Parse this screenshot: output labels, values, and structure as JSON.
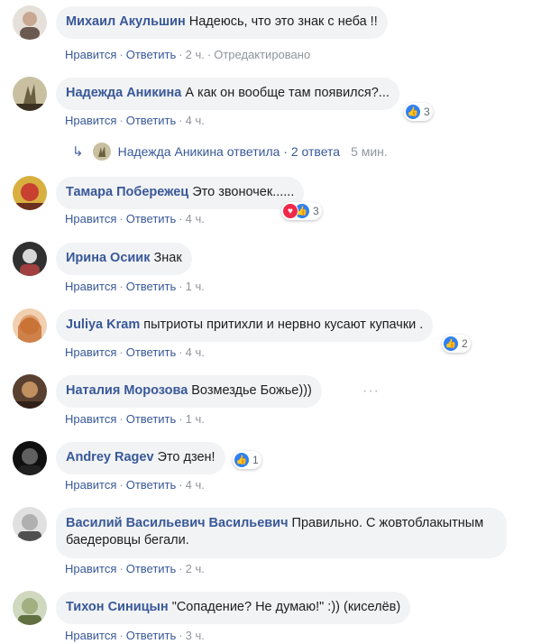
{
  "comments": [
    {
      "author": "Михаил Акульшин",
      "text": "Надеюсь, что это знак с неба !!",
      "like": "Нравится",
      "reply": "Ответить",
      "time": "2 ч.",
      "edited": "Отредактировано",
      "colors": [
        "#e6e0da",
        "#c8a890",
        "#6a5a50"
      ]
    },
    {
      "author": "Надежда Аникина",
      "text": "А как он вообще там появился?...",
      "like": "Нравится",
      "reply": "Ответить",
      "time": "4 ч.",
      "reactions": "3",
      "colors": [
        "#c8c0a0",
        "#6a6040",
        "#3a3020"
      ]
    },
    {
      "author": "Тамара Побережец",
      "text": "Это звоночек......",
      "like": "Нравится",
      "reply": "Ответить",
      "time": "4 ч.",
      "reactions": "3",
      "colors": [
        "#d8b040",
        "#c84030",
        "#6a3020"
      ]
    },
    {
      "author": "Ирина Осиик",
      "text": "Знак",
      "like": "Нравится",
      "reply": "Ответить",
      "time": "1 ч.",
      "colors": [
        "#303030",
        "#a04040",
        "#d8d8d8"
      ]
    },
    {
      "author": "Juliya Kram",
      "text": "пытриоты притихли и нервно кусают купачки .",
      "like": "Нравится",
      "reply": "Ответить",
      "time": "4 ч.",
      "reactions": "2",
      "colors": [
        "#e0a070",
        "#c06020",
        "#f0d0b0"
      ]
    },
    {
      "author": "Наталия Морозова",
      "text": "Возмездье Божье)))",
      "like": "Нравится",
      "reply": "Ответить",
      "time": "1 ч.",
      "colors": [
        "#5a4030",
        "#c09060",
        "#302018"
      ]
    },
    {
      "author": "Andrey Ragev",
      "text": "Это дзен!",
      "like": "Нравится",
      "reply": "Ответить",
      "time": "4 ч.",
      "reactions": "1",
      "colors": [
        "#202020",
        "#606060",
        "#101010"
      ]
    },
    {
      "author": "Василий Васильевич Васильевич",
      "text": "Правильно. С жовтоблакытным баедеровцы бегали.",
      "like": "Нравится",
      "reply": "Ответить",
      "time": "2 ч.",
      "colors": [
        "#b0b0b0",
        "#505050",
        "#e0e0e0"
      ]
    },
    {
      "author": "Тихон Синицын",
      "text": "\"Сопадение? Не думаю!\" :)) (киселёв)",
      "like": "Нравится",
      "reply": "Ответить",
      "time": "3 ч.",
      "colors": [
        "#a0b080",
        "#607040",
        "#d0d8c0"
      ]
    }
  ],
  "reply_summary": {
    "arrow": "↳",
    "text": "Надежда Аникина ответила · 2 ответа",
    "time": "5 мин."
  },
  "dot": "·",
  "more": "···",
  "colors": {
    "link": "#385898",
    "bubble": "#f2f3f5",
    "like": "#2e80f5",
    "love": "#f0284a"
  }
}
